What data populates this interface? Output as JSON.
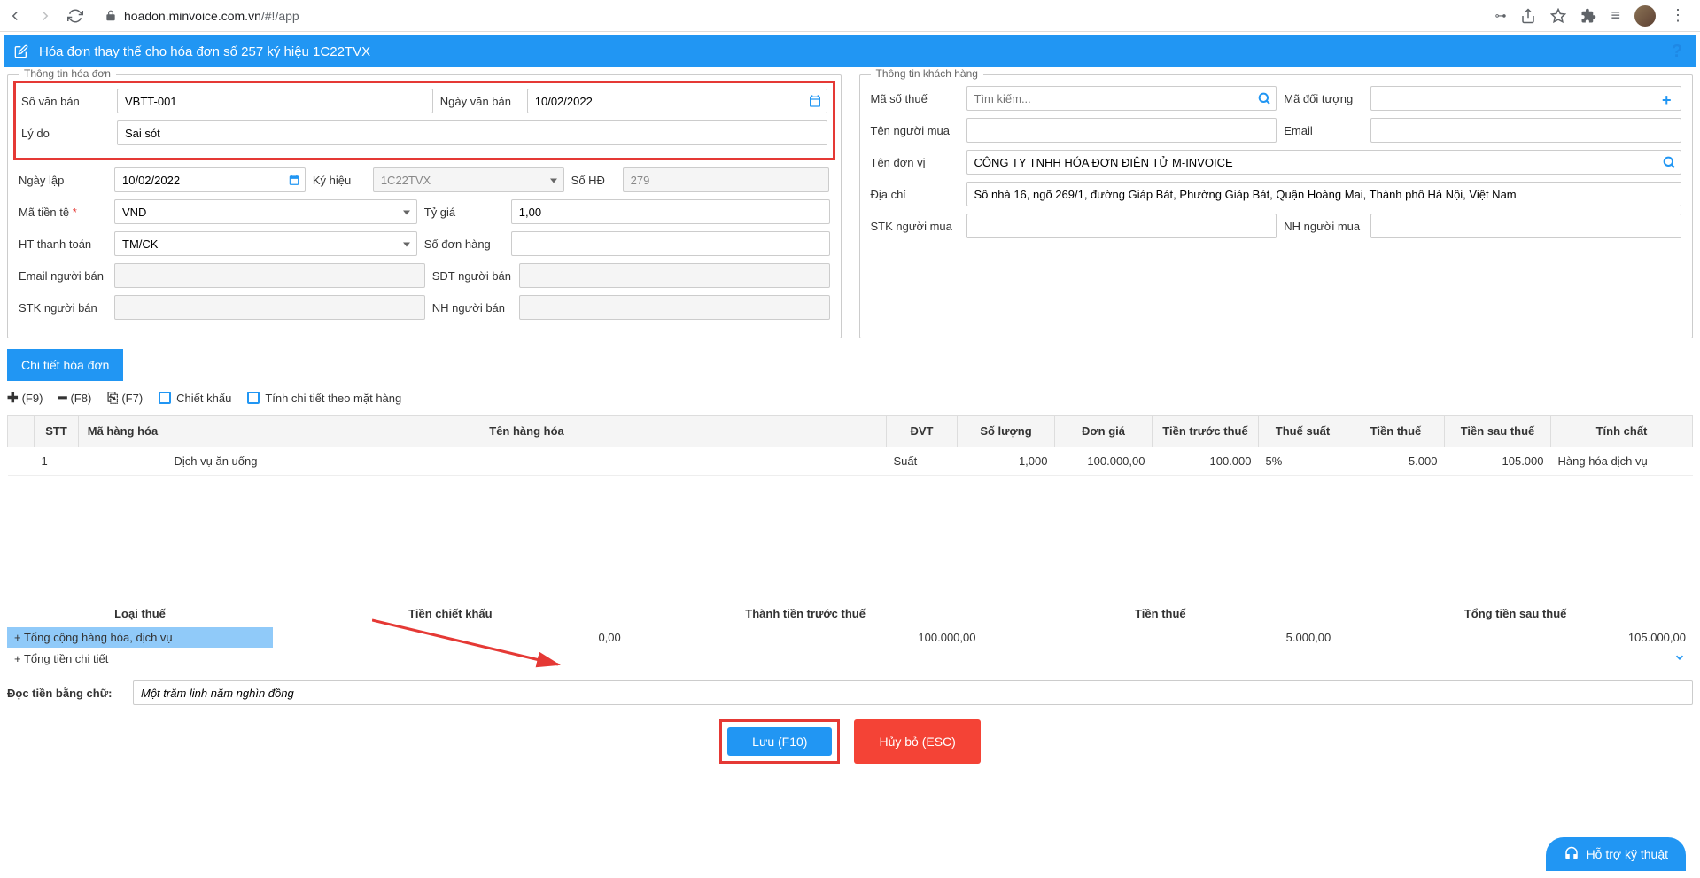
{
  "browser": {
    "url_host": "hoadon.minvoice.com.vn",
    "url_path": "/#!/app"
  },
  "header": {
    "title": "Hóa đơn thay thế cho hóa đơn số 257 ký hiệu 1C22TVX"
  },
  "invoice_info": {
    "legend": "Thông tin hóa đơn",
    "doc_no_label": "Số văn bản",
    "doc_no": "VBTT-001",
    "doc_date_label": "Ngày văn bản",
    "doc_date": "10/02/2022",
    "reason_label": "Lý do",
    "reason": "Sai sót",
    "issue_date_label": "Ngày lập",
    "issue_date": "10/02/2022",
    "serial_label": "Ký hiệu",
    "serial": "1C22TVX",
    "inv_no_label": "Số HĐ",
    "inv_no": "279",
    "currency_label": "Mã tiền tệ",
    "currency": "VND",
    "rate_label": "Tỷ giá",
    "rate": "1,00",
    "pay_method_label": "HT thanh toán",
    "pay_method": "TM/CK",
    "order_no_label": "Số đơn hàng",
    "seller_email_label": "Email người bán",
    "seller_phone_label": "SDT người bán",
    "seller_acc_label": "STK người bán",
    "seller_bank_label": "NH người bán"
  },
  "customer_info": {
    "legend": "Thông tin khách hàng",
    "tax_label": "Mã số thuế",
    "tax_placeholder": "Tìm kiếm...",
    "partner_code_label": "Mã đối tượng",
    "buyer_name_label": "Tên người mua",
    "email_label": "Email",
    "company_label": "Tên đơn vị",
    "company": "CÔNG TY TNHH HÓA ĐƠN ĐIỆN TỬ M-INVOICE",
    "address_label": "Địa chỉ",
    "address": "Số nhà 16, ngõ 269/1, đường Giáp Bát, Phường Giáp Bát, Quận Hoàng Mai, Thành phố Hà Nội, Việt Nam",
    "buyer_acc_label": "STK người mua",
    "buyer_bank_label": "NH người mua"
  },
  "tabs": {
    "detail": "Chi tiết hóa đơn"
  },
  "toolbar": {
    "add": "(F9)",
    "remove": "(F8)",
    "copy": "(F7)",
    "discount": "Chiết khấu",
    "detail_by_item": "Tính chi tiết theo mặt hàng"
  },
  "table": {
    "headers": [
      "",
      "STT",
      "Mã hàng hóa",
      "Tên hàng hóa",
      "ĐVT",
      "Số lượng",
      "Đơn giá",
      "Tiền trước thuế",
      "Thuế suất",
      "Tiền thuế",
      "Tiền sau thuế",
      "Tính chất"
    ],
    "rows": [
      {
        "stt": "1",
        "code": "",
        "name": "Dịch vụ ăn uống",
        "unit": "Suất",
        "qty": "1,000",
        "price": "100.000,00",
        "pretax": "100.000",
        "taxrate": "5%",
        "tax": "5.000",
        "posttax": "105.000",
        "nature": "Hàng hóa dịch vụ"
      }
    ]
  },
  "summary": {
    "headers": [
      "Loại thuế",
      "Tiền chiết khấu",
      "Thành tiền trước thuế",
      "Tiền thuế",
      "Tổng tiền sau thuế"
    ],
    "total_goods_label": "+ Tổng cộng hàng hóa, dịch vụ",
    "total_detail_label": "+ Tổng tiền chi tiết",
    "discount": "0,00",
    "pretax": "100.000,00",
    "tax": "5.000,00",
    "posttax": "105.000,00"
  },
  "words": {
    "label": "Đọc tiền bằng chữ:",
    "value": "Một trăm linh năm nghìn đồng"
  },
  "actions": {
    "save": "Lưu (F10)",
    "cancel": "Hủy bỏ (ESC)"
  },
  "support": "Hỗ trợ kỹ thuật"
}
